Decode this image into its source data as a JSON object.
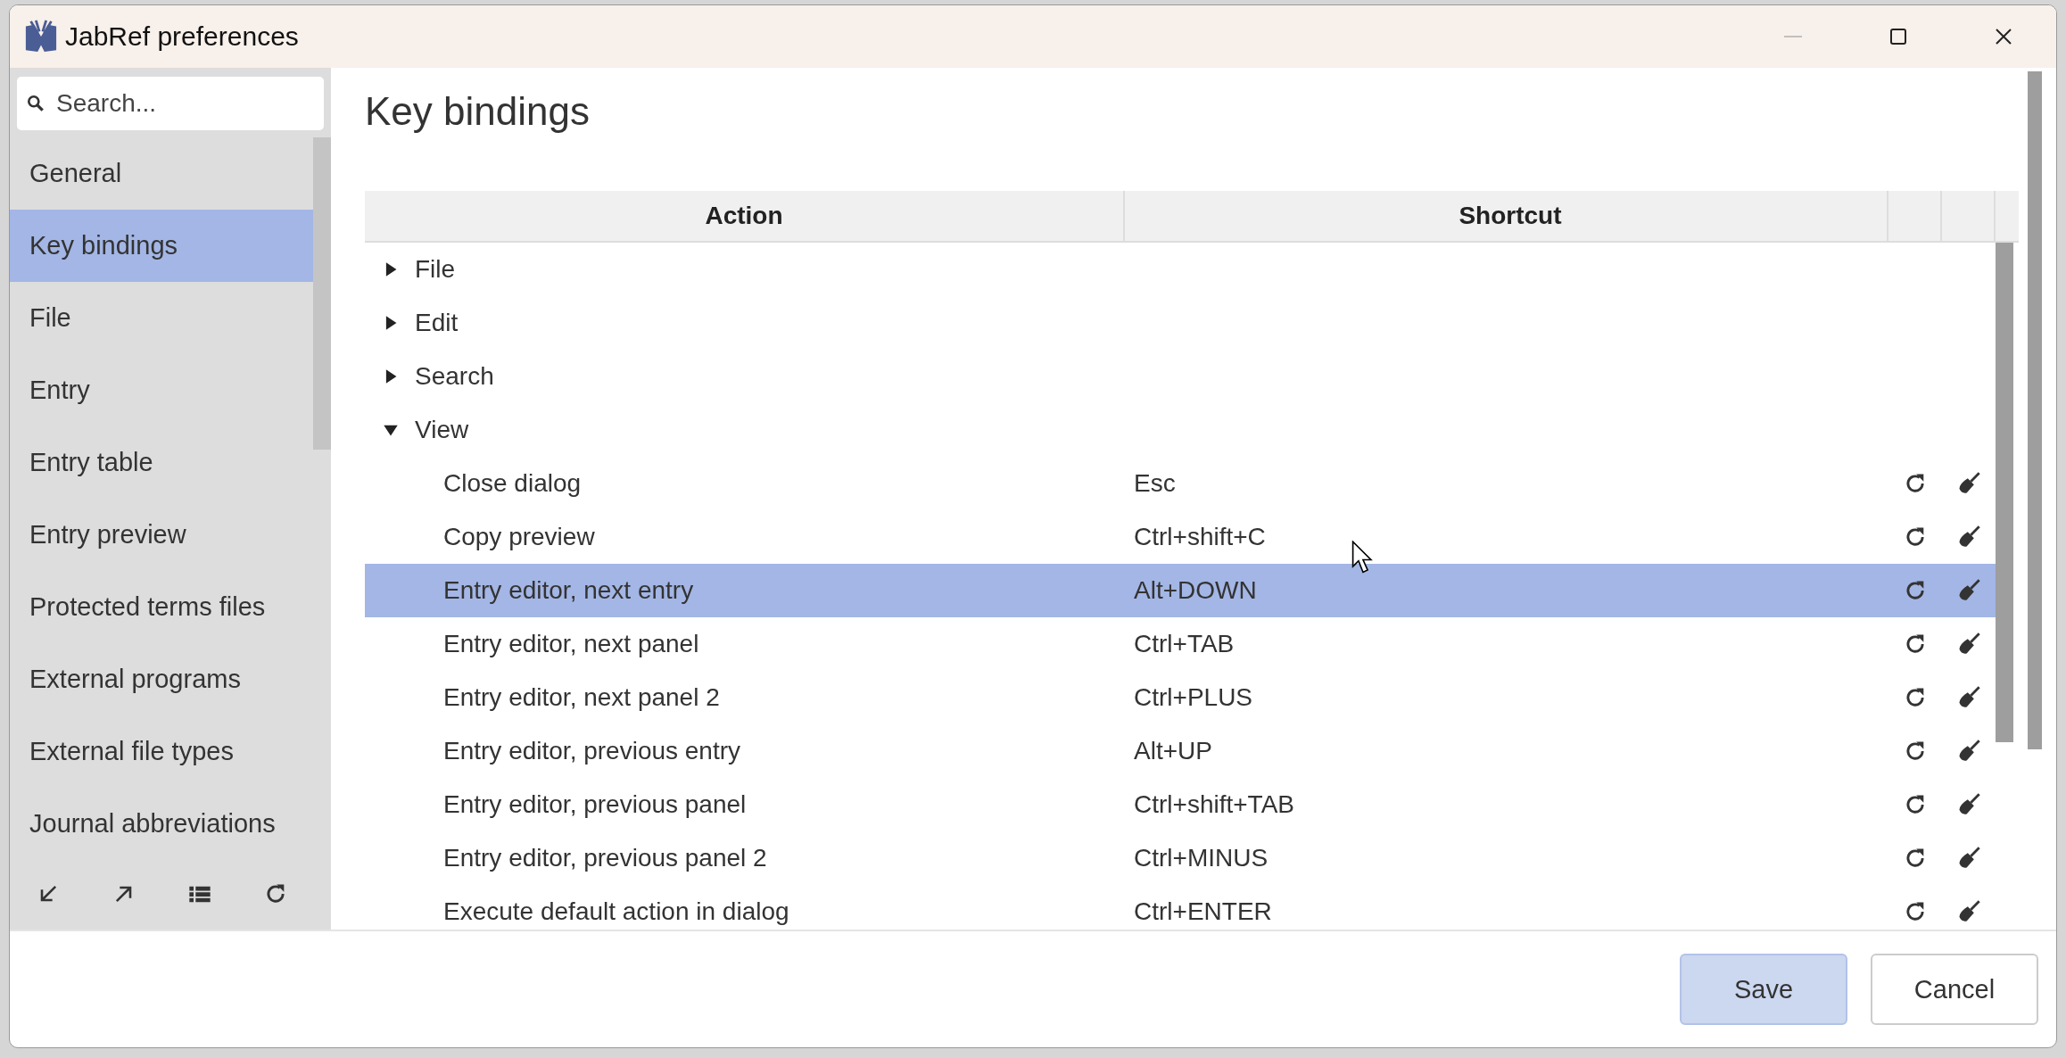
{
  "window": {
    "title": "JabRef preferences"
  },
  "sidebar": {
    "search": {
      "placeholder": "Search..."
    },
    "items": [
      {
        "label": "General",
        "selected": false
      },
      {
        "label": "Key bindings",
        "selected": true
      },
      {
        "label": "File",
        "selected": false
      },
      {
        "label": "Entry",
        "selected": false
      },
      {
        "label": "Entry table",
        "selected": false
      },
      {
        "label": "Entry preview",
        "selected": false
      },
      {
        "label": "Protected terms files",
        "selected": false
      },
      {
        "label": "External programs",
        "selected": false
      },
      {
        "label": "External file types",
        "selected": false
      },
      {
        "label": "Journal abbreviations",
        "selected": false
      }
    ]
  },
  "page": {
    "title": "Key bindings"
  },
  "table": {
    "columns": [
      "Action",
      "Shortcut"
    ],
    "rows": [
      {
        "action": "File",
        "expanded": false,
        "selected": false
      },
      {
        "action": "Edit",
        "expanded": false,
        "selected": false
      },
      {
        "action": "Search",
        "expanded": false,
        "selected": false
      },
      {
        "action": "View",
        "expanded": true,
        "selected": false,
        "children": [
          {
            "action": "Close dialog",
            "shortcut": "Esc",
            "selected": false
          },
          {
            "action": "Copy preview",
            "shortcut": "Ctrl+shift+C",
            "selected": false
          },
          {
            "action": "Entry editor, next entry",
            "shortcut": "Alt+DOWN",
            "selected": true
          },
          {
            "action": "Entry editor, next panel",
            "shortcut": "Ctrl+TAB",
            "selected": false
          },
          {
            "action": "Entry editor, next panel 2",
            "shortcut": "Ctrl+PLUS",
            "selected": false
          },
          {
            "action": "Entry editor, previous entry",
            "shortcut": "Alt+UP",
            "selected": false
          },
          {
            "action": "Entry editor, previous panel",
            "shortcut": "Ctrl+shift+TAB",
            "selected": false
          },
          {
            "action": "Entry editor, previous panel 2",
            "shortcut": "Ctrl+MINUS",
            "selected": false
          },
          {
            "action": "Execute default action in dialog",
            "shortcut": "Ctrl+ENTER",
            "selected": false
          }
        ]
      }
    ]
  },
  "buttons": [
    {
      "label": "Save",
      "kind": "default"
    },
    {
      "label": "Cancel",
      "kind": "normal"
    }
  ]
}
